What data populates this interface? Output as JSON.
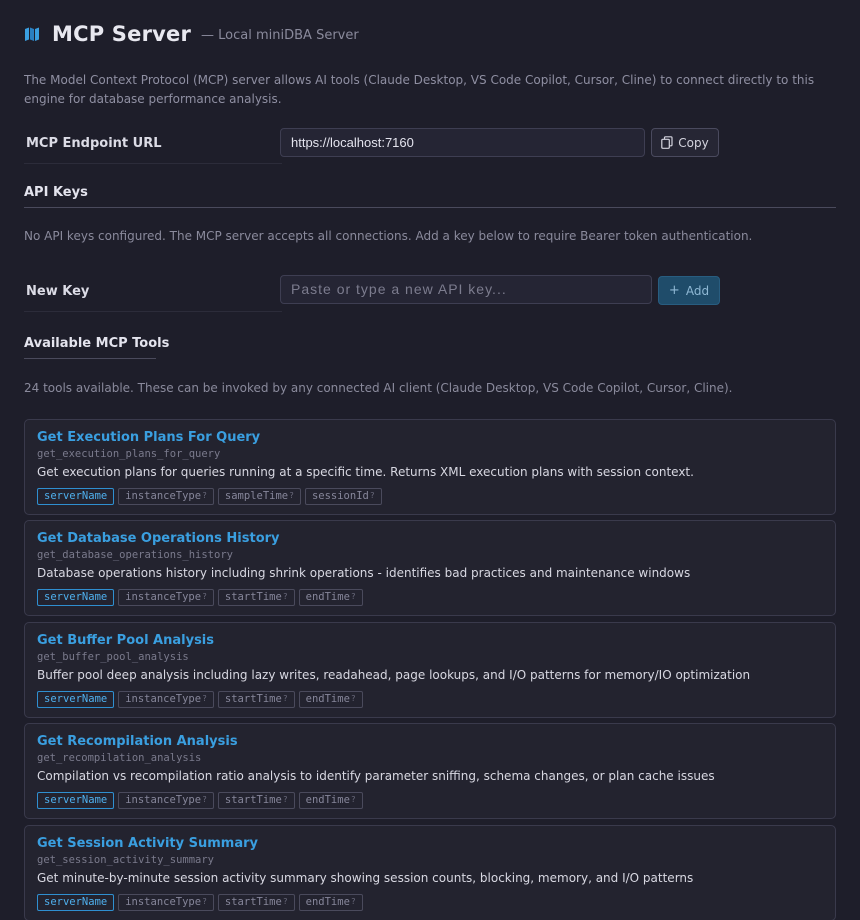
{
  "header": {
    "title": "MCP Server",
    "subtitle": "— Local miniDBA Server",
    "icon": "map-icon"
  },
  "intro": "The Model Context Protocol (MCP) server allows AI tools (Claude Desktop, VS Code Copilot, Cursor, Cline) to connect directly to this engine for database performance analysis.",
  "endpoint": {
    "label": "MCP Endpoint URL",
    "value": "https://localhost:7160",
    "copy_label": "Copy"
  },
  "api_keys": {
    "title": "API Keys",
    "note": "No API keys configured. The MCP server accepts all connections. Add a key below to require Bearer token authentication.",
    "new_key_label": "New Key",
    "placeholder": "Paste or type a new API key...",
    "add_label": "Add"
  },
  "tools_section": {
    "title": "Available MCP Tools",
    "note": "24 tools available. These can be invoked by any connected AI client (Claude Desktop, VS Code Copilot, Cursor, Cline).",
    "optional_marker": "?"
  },
  "tools": [
    {
      "title": "Get Execution Plans For Query",
      "id": "get_execution_plans_for_query",
      "description": "Get execution plans for queries running at a specific time. Returns XML execution plans with session context.",
      "params": [
        "serverName",
        "instanceType",
        "sampleTime",
        "sessionId"
      ]
    },
    {
      "title": "Get Database Operations History",
      "id": "get_database_operations_history",
      "description": "Database operations history including shrink operations - identifies bad practices and maintenance windows",
      "params": [
        "serverName",
        "instanceType",
        "startTime",
        "endTime"
      ]
    },
    {
      "title": "Get Buffer Pool Analysis",
      "id": "get_buffer_pool_analysis",
      "description": "Buffer pool deep analysis including lazy writes, readahead, page lookups, and I/O patterns for memory/IO optimization",
      "params": [
        "serverName",
        "instanceType",
        "startTime",
        "endTime"
      ]
    },
    {
      "title": "Get Recompilation Analysis",
      "id": "get_recompilation_analysis",
      "description": "Compilation vs recompilation ratio analysis to identify parameter sniffing, schema changes, or plan cache issues",
      "params": [
        "serverName",
        "instanceType",
        "startTime",
        "endTime"
      ]
    },
    {
      "title": "Get Session Activity Summary",
      "id": "get_session_activity_summary",
      "description": "Get minute-by-minute session activity summary showing session counts, blocking, memory, and I/O patterns",
      "params": [
        "serverName",
        "instanceType",
        "startTime",
        "endTime"
      ]
    }
  ],
  "colors": {
    "background": "#1e1e2a",
    "accent": "#3a9fe0",
    "add_button": "#1f4c6a"
  }
}
